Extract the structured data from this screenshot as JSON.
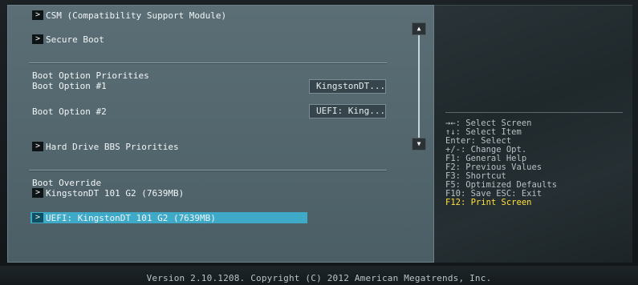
{
  "menu": {
    "items": [
      {
        "label": "CSM (Compatibility Support Module)",
        "arrow": ">"
      },
      {
        "label": "Secure Boot",
        "arrow": ">"
      },
      {
        "label": "Hard Drive BBS Priorities",
        "arrow": ">"
      },
      {
        "label": "KingstonDT 101 G2  (7639MB)",
        "arrow": ">"
      },
      {
        "label": "UEFI: KingstonDT 101 G2 (7639MB)",
        "arrow": ">"
      }
    ],
    "sections": {
      "boot_priorities": "Boot Option Priorities",
      "boot_override": "Boot Override"
    },
    "options": [
      {
        "label": "Boot Option #1",
        "value": "KingstonDT..."
      },
      {
        "label": "Boot Option #2",
        "value": "UEFI: King..."
      }
    ]
  },
  "scrollbar": {
    "up_glyph": "▲",
    "down_glyph": "▼"
  },
  "help": [
    "→←: Select Screen",
    "↑↓: Select Item",
    "Enter: Select",
    "+/-: Change Opt.",
    "F1: General Help",
    "F2: Previous Values",
    "F3: Shortcut",
    "F5: Optimized Defaults",
    "F10: Save  ESC: Exit",
    "F12: Print Screen"
  ],
  "footer": {
    "version": "Version 2.10.1208. Copyright (C) 2012 American Megatrends, Inc."
  },
  "colors": {
    "highlight": "#3fa9c8",
    "hotkey": "#ffe23a",
    "panel": "#55686f"
  }
}
